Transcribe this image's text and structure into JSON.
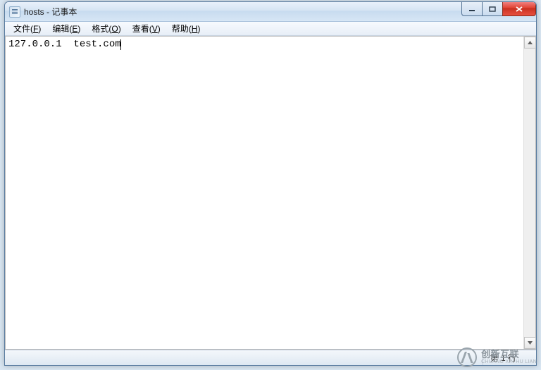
{
  "window": {
    "title": "hosts - 记事本"
  },
  "menu": {
    "file": {
      "label": "文件",
      "accel": "F"
    },
    "edit": {
      "label": "编辑",
      "accel": "E"
    },
    "format": {
      "label": "格式",
      "accel": "O"
    },
    "view": {
      "label": "查看",
      "accel": "V"
    },
    "help": {
      "label": "帮助",
      "accel": "H"
    }
  },
  "editor": {
    "content": "127.0.0.1  test.com"
  },
  "statusbar": {
    "position": "第 1 行"
  },
  "watermark": {
    "cn": "创新互联",
    "en": "CHUANG XIN HU LIAN"
  }
}
